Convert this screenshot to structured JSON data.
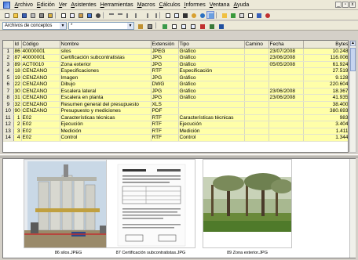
{
  "menu": [
    "Archivo",
    "Edición",
    "Ver",
    "Asistentes",
    "Herramientas",
    "Macros",
    "Cálculos",
    "Informes",
    "Ventana",
    "Ayuda"
  ],
  "window_controls": [
    "_",
    "▫",
    "x"
  ],
  "toolbar2": {
    "concept_combo": "Archivos de conceptos",
    "filter_combo": "*"
  },
  "table": {
    "columns": [
      "Id",
      "Código",
      "Nombre",
      "Extensión",
      "Tipo",
      "Camino",
      "Fecha",
      "Bytes"
    ],
    "rows": [
      {
        "n": "1",
        "id": "86",
        "code": "40000001",
        "name": "silos",
        "ext": "JPEG",
        "type": "Gráfico",
        "path": "",
        "date": "23/07/2008",
        "bytes": "10.248"
      },
      {
        "n": "2",
        "id": "87",
        "code": "40000001",
        "name": "Certificación subcontratistas",
        "ext": "JPG",
        "type": "Gráfico",
        "path": "",
        "date": "23/06/2008",
        "bytes": "116.006"
      },
      {
        "n": "3",
        "id": "89",
        "code": "ACT0010",
        "name": "Zona exterior",
        "ext": "JPG",
        "type": "Gráfico",
        "path": "",
        "date": "05/05/2008",
        "bytes": "61.924"
      },
      {
        "n": "4",
        "id": "18",
        "code": "CENZANO",
        "name": "Especificaciones",
        "ext": "RTF",
        "type": "Especificación",
        "path": "",
        "date": "",
        "bytes": "27.519"
      },
      {
        "n": "5",
        "id": "19",
        "code": "CENZANO",
        "name": "Imagen",
        "ext": "JPG",
        "type": "Gráfico",
        "path": "",
        "date": "",
        "bytes": "9.128"
      },
      {
        "n": "6",
        "id": "22",
        "code": "CENZANO",
        "name": "Dibujo",
        "ext": "DWG",
        "type": "Gráfico",
        "path": "",
        "date": "",
        "bytes": "220.604"
      },
      {
        "n": "7",
        "id": "30",
        "code": "CENZANO",
        "name": "Escalera lateral",
        "ext": "JPG",
        "type": "Gráfico",
        "path": "",
        "date": "23/06/2008",
        "bytes": "18.367"
      },
      {
        "n": "8",
        "id": "31",
        "code": "CENZANO",
        "name": "Escalera en planta",
        "ext": "JPG",
        "type": "Gráfico",
        "path": "",
        "date": "23/06/2008",
        "bytes": "41.935"
      },
      {
        "n": "9",
        "id": "32",
        "code": "CENZANO",
        "name": "Resumen general del presupuesto",
        "ext": "XLS",
        "type": "",
        "path": "",
        "date": "",
        "bytes": "38.400"
      },
      {
        "n": "10",
        "id": "90",
        "code": "CENZANO",
        "name": "Presupuesto y mediciones",
        "ext": "PDF",
        "type": "",
        "path": "",
        "date": "",
        "bytes": "380.693"
      },
      {
        "n": "11",
        "id": "1",
        "code": "E02",
        "name": "Características técnicas",
        "ext": "RTF",
        "type": "Características técnicas",
        "path": "",
        "date": "",
        "bytes": "983"
      },
      {
        "n": "12",
        "id": "2",
        "code": "E02",
        "name": "Ejecución",
        "ext": "RTF",
        "type": "Ejecución",
        "path": "",
        "date": "",
        "bytes": "3.404"
      },
      {
        "n": "13",
        "id": "3",
        "code": "E02",
        "name": "Medición",
        "ext": "RTF",
        "type": "Medición",
        "path": "",
        "date": "",
        "bytes": "1.411"
      },
      {
        "n": "14",
        "id": "4",
        "code": "E02",
        "name": "Control",
        "ext": "RTF",
        "type": "Control",
        "path": "",
        "date": "",
        "bytes": "1.344"
      }
    ]
  },
  "gallery": [
    {
      "caption": "86  silos.JPEG",
      "kind": "photo-silos"
    },
    {
      "caption": "87  Certificación subcontratistas.JPG",
      "kind": "document"
    },
    {
      "caption": "89  Zona exterior.JPG",
      "kind": "photo-trees"
    }
  ],
  "colors": {
    "row_highlight": "#ffffa8",
    "chrome": "#ece9d8"
  }
}
